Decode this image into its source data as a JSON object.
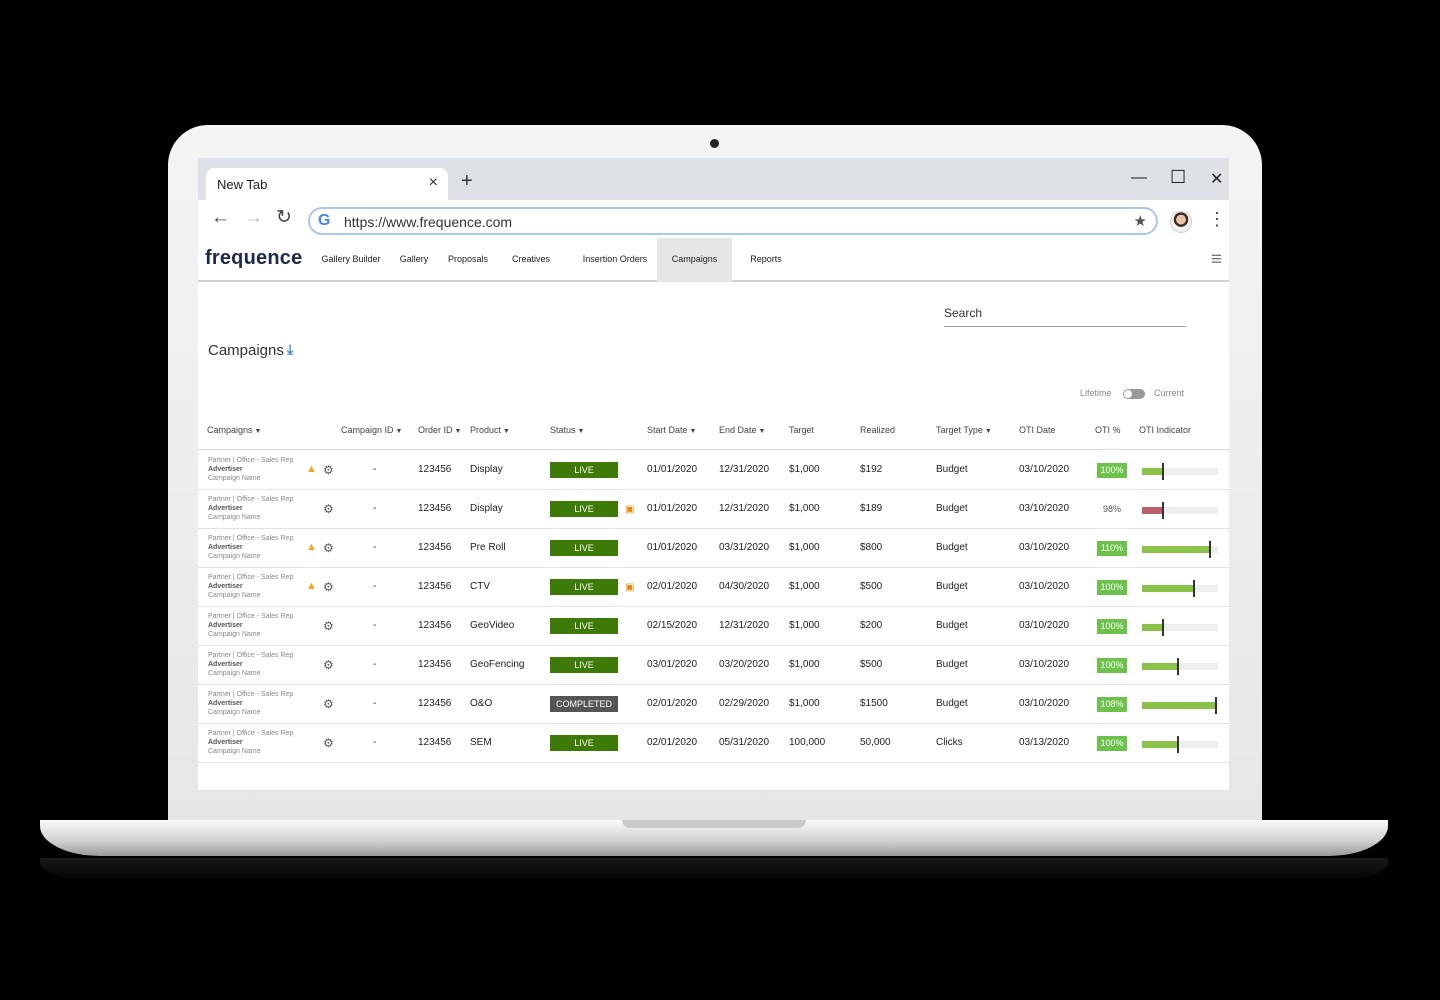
{
  "browser": {
    "tab_title": "New Tab",
    "new_tab": "+",
    "url": "https://www.frequence.com",
    "close": "×",
    "minimize": "—",
    "maximize": "☐",
    "window_close": "✕"
  },
  "app": {
    "logo": "frequence",
    "nav": [
      {
        "label": "Gallery Builder"
      },
      {
        "label": "Gallery"
      },
      {
        "label": "Proposals"
      },
      {
        "label": "Creatives"
      },
      {
        "label": "Insertion Orders"
      },
      {
        "label": "Campaigns",
        "active": true
      },
      {
        "label": "Reports"
      }
    ]
  },
  "page": {
    "title": "Campaigns",
    "search_label": "Search",
    "toggle_left": "Lifetime",
    "toggle_right": "Current"
  },
  "table": {
    "headers": [
      "Campaigns",
      "Campaign ID",
      "Order ID",
      "Product",
      "Status",
      "Start Date",
      "End Date",
      "Target",
      "Realized",
      "Target Type",
      "OTI Date",
      "OTI %",
      "OTI Indicator"
    ],
    "meta": {
      "line1": "Partner | Office - Sales Rep",
      "line2": "Advertiser",
      "line3": "Campaign Name"
    },
    "rows": [
      {
        "warn": true,
        "campaign_id": "-",
        "order_id": "123456",
        "product": "Display",
        "status": "LIVE",
        "calendar": false,
        "start": "01/01/2020",
        "end": "12/31/2020",
        "target": "$1,000",
        "realized": "$192",
        "target_type": "Budget",
        "oti_date": "03/10/2020",
        "oti_pct": "100%",
        "oti_plain": false,
        "fill": 0.27,
        "red": false
      },
      {
        "warn": false,
        "campaign_id": "-",
        "order_id": "123456",
        "product": "Display",
        "status": "LIVE",
        "calendar": true,
        "start": "01/01/2020",
        "end": "12/31/2020",
        "target": "$1,000",
        "realized": "$189",
        "target_type": "Budget",
        "oti_date": "03/10/2020",
        "oti_pct": "98%",
        "oti_plain": true,
        "fill": 0.27,
        "red": true
      },
      {
        "warn": true,
        "campaign_id": "-",
        "order_id": "123456",
        "product": "Pre Roll",
        "status": "LIVE",
        "calendar": false,
        "start": "01/01/2020",
        "end": "03/31/2020",
        "target": "$1,000",
        "realized": "$800",
        "target_type": "Budget",
        "oti_date": "03/10/2020",
        "oti_pct": "110%",
        "oti_plain": false,
        "fill": 0.9,
        "red": false
      },
      {
        "warn": true,
        "campaign_id": "-",
        "order_id": "123456",
        "product": "CTV",
        "status": "LIVE",
        "calendar": true,
        "start": "02/01/2020",
        "end": "04/30/2020",
        "target": "$1,000",
        "realized": "$500",
        "target_type": "Budget",
        "oti_date": "03/10/2020",
        "oti_pct": "100%",
        "oti_plain": false,
        "fill": 0.69,
        "red": false
      },
      {
        "warn": false,
        "campaign_id": "-",
        "order_id": "123456",
        "product": "GeoVideo",
        "status": "LIVE",
        "calendar": false,
        "start": "02/15/2020",
        "end": "12/31/2020",
        "target": "$1,000",
        "realized": "$200",
        "target_type": "Budget",
        "oti_date": "03/10/2020",
        "oti_pct": "100%",
        "oti_plain": false,
        "fill": 0.27,
        "red": false
      },
      {
        "warn": false,
        "campaign_id": "-",
        "order_id": "123456",
        "product": "GeoFencing",
        "status": "LIVE",
        "calendar": false,
        "start": "03/01/2020",
        "end": "03/20/2020",
        "target": "$1,000",
        "realized": "$500",
        "target_type": "Budget",
        "oti_date": "03/10/2020",
        "oti_pct": "100%",
        "oti_plain": false,
        "fill": 0.48,
        "red": false
      },
      {
        "warn": false,
        "campaign_id": "-",
        "order_id": "123456",
        "product": "O&O",
        "status": "COMPLETED",
        "calendar": false,
        "start": "02/01/2020",
        "end": "02/29/2020",
        "target": "$1,000",
        "realized": "$1500",
        "target_type": "Budget",
        "oti_date": "03/10/2020",
        "oti_pct": "108%",
        "oti_plain": false,
        "fill": 0.98,
        "red": false
      },
      {
        "warn": false,
        "campaign_id": "-",
        "order_id": "123456",
        "product": "SEM",
        "status": "LIVE",
        "calendar": false,
        "start": "02/01/2020",
        "end": "05/31/2020",
        "target": "100,000",
        "realized": "50,000",
        "target_type": "Clicks",
        "oti_date": "03/13/2020",
        "oti_pct": "100%",
        "oti_plain": false,
        "fill": 0.48,
        "red": false
      }
    ]
  },
  "icons": {
    "warn": "warning-icon",
    "gear": "gear-icon",
    "calendar": "calendar-icon",
    "download": "download-icon"
  }
}
